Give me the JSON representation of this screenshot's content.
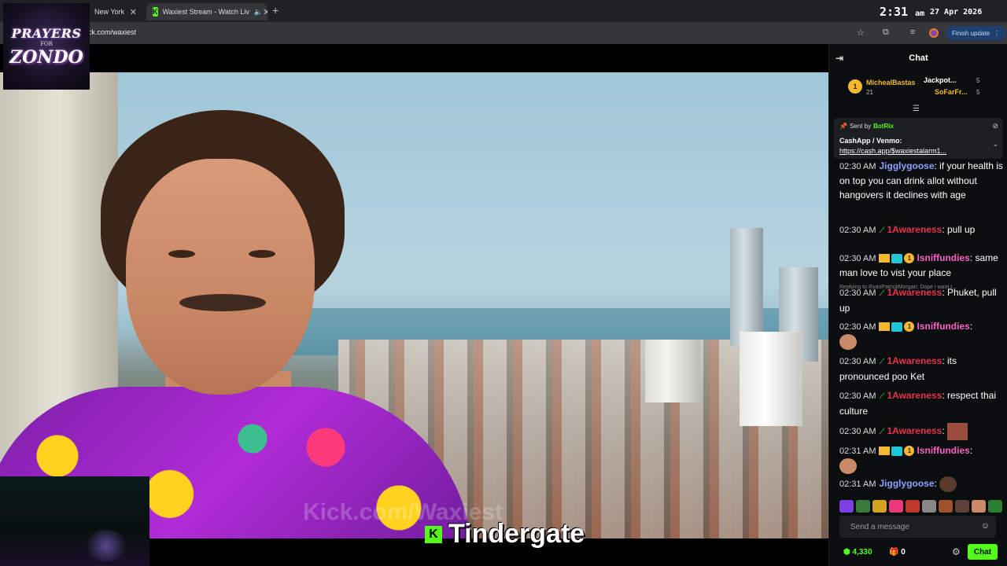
{
  "browser": {
    "tabs": [
      {
        "title": "New York"
      },
      {
        "title": "Waxiest Stream - Watch Liv"
      }
    ],
    "url": "ck.com/waxiest",
    "finish_update": "Finish update"
  },
  "overlay": {
    "clock_time": "2:31",
    "clock_ampm": "am",
    "date": "27 Apr 2026",
    "logo_top": "PRAYERS",
    "logo_for": "FOR",
    "logo_name": "ZONDO"
  },
  "stream": {
    "watermark": "Kick.com/Waxiest",
    "caption": "Tindergate"
  },
  "chat": {
    "title": "Chat",
    "leaderboard": [
      {
        "rank": "1",
        "name": "MichealBastas",
        "count": "21"
      },
      {
        "name": "Jackpot...",
        "count": "5"
      },
      {
        "name": "SoFarFr...",
        "count": "5"
      }
    ],
    "pinned": {
      "sent_by": "Sent by",
      "bot": "BotRix",
      "line1": "CashApp / Venmo:",
      "line2": "https://cash.app/$waxiestalarm1..."
    },
    "reply_text": "Replying to RyanPatrickMorgan: Dope i want t...",
    "messages": [
      {
        "time": "02:30 AM",
        "user": "Jigglygoose",
        "text": ": if your health is on top you can drink allot without hangovers it declines with age"
      },
      {
        "time": "02:30 AM",
        "user": "1Awareness",
        "text": ": pull up"
      },
      {
        "time": "02:30 AM",
        "user": "Isniffundies",
        "text": ": same man love to vist your place"
      },
      {
        "time": "02:30 AM",
        "user": "1Awareness",
        "text": ": Phuket, pull up"
      },
      {
        "time": "02:30 AM",
        "user": "Isniffundies",
        "text": ":"
      },
      {
        "time": "02:30 AM",
        "user": "1Awareness",
        "text": ": its pronounced poo Ket"
      },
      {
        "time": "02:30 AM",
        "user": "1Awareness",
        "text": ": respect thai culture"
      },
      {
        "time": "02:30 AM",
        "user": "1Awareness",
        "text": ":"
      },
      {
        "time": "02:31 AM",
        "user": "Isniffundies",
        "text": ":"
      },
      {
        "time": "02:31 AM",
        "user": "Jigglygoose",
        "text": ":"
      }
    ],
    "input_placeholder": "Send a message",
    "points": "4,330",
    "gifts": "0",
    "send_label": "Chat"
  }
}
